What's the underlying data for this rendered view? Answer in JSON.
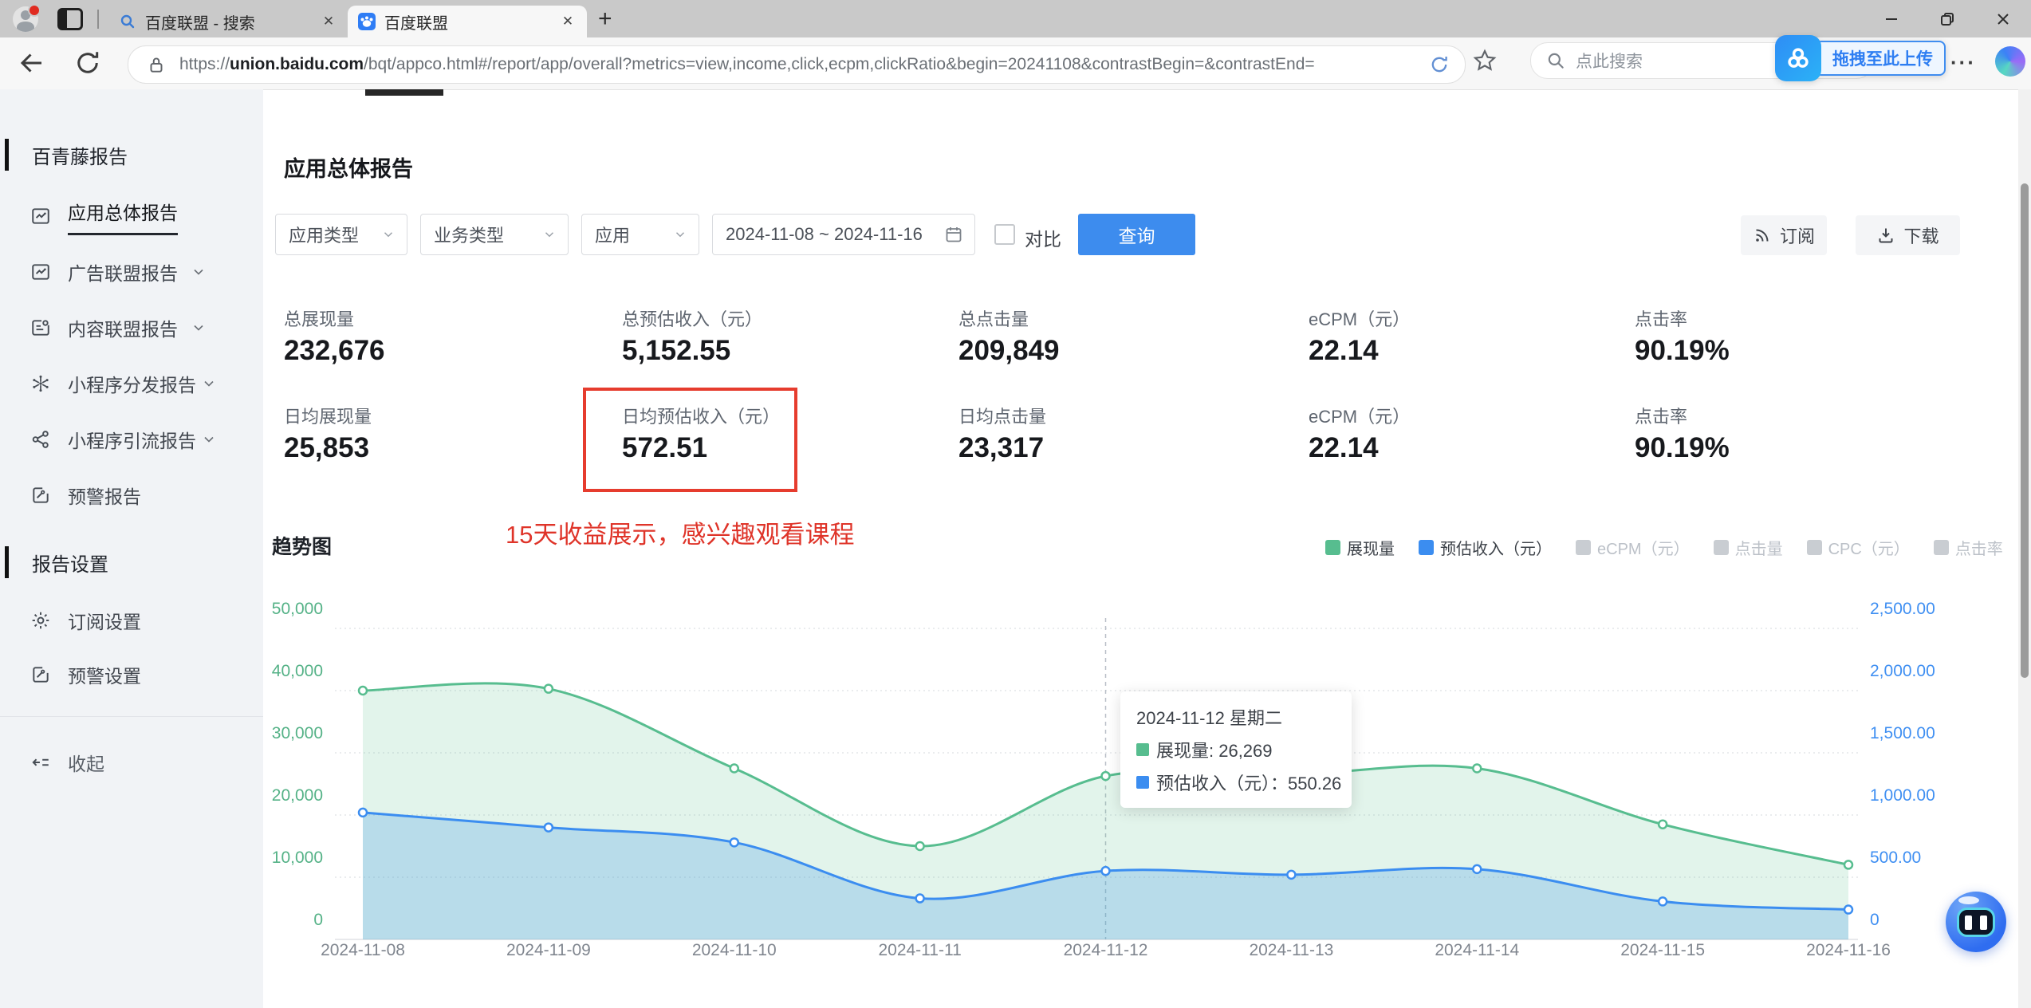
{
  "browser": {
    "tabs": [
      {
        "title": "百度联盟 - 搜索"
      },
      {
        "title": "百度联盟"
      }
    ],
    "url_prefix": "https://",
    "url_domain": "union.baidu.com",
    "url_path": "/bqt/appco.html#/report/app/overall?metrics=view,income,click,ecpm,clickRatio&begin=20241108&contrastBegin=&contrastEnd=",
    "search_placeholder": "点此搜索",
    "netdisk_badge": "拖拽至此上传"
  },
  "sidebar": {
    "section1": {
      "title": "百青藤报告"
    },
    "items1": [
      {
        "label": "应用总体报告"
      },
      {
        "label": "广告联盟报告"
      },
      {
        "label": "内容联盟报告"
      },
      {
        "label": "小程序分发报告"
      },
      {
        "label": "小程序引流报告"
      },
      {
        "label": "预警报告"
      }
    ],
    "section2": {
      "title": "报告设置"
    },
    "items2": [
      {
        "label": "订阅设置"
      },
      {
        "label": "预警设置"
      }
    ],
    "collapse": "收起"
  },
  "main": {
    "title": "应用总体报告",
    "filters": {
      "app_type": "应用类型",
      "biz_type": "业务类型",
      "app": "应用",
      "date_range": "2024-11-08 ~ 2024-11-16",
      "compare": "对比",
      "query": "查询",
      "subscribe": "订阅",
      "download": "下载"
    },
    "stats_row1": [
      {
        "label": "总展现量",
        "value": "232,676"
      },
      {
        "label": "总预估收入（元）",
        "value": "5,152.55"
      },
      {
        "label": "总点击量",
        "value": "209,849"
      },
      {
        "label": "eCPM（元）",
        "value": "22.14"
      },
      {
        "label": "点击率",
        "value": "90.19%"
      }
    ],
    "stats_row2": [
      {
        "label": "日均展现量",
        "value": "25,853"
      },
      {
        "label": "日均预估收入（元）",
        "value": "572.51"
      },
      {
        "label": "日均点击量",
        "value": "23,317"
      },
      {
        "label": "eCPM（元）",
        "value": "22.14"
      },
      {
        "label": "点击率",
        "value": "90.19%"
      }
    ],
    "annotation": "15天收益展示，感兴趣观看课程"
  },
  "chart_data": {
    "type": "area",
    "title": "趋势图",
    "x": [
      "2024-11-08",
      "2024-11-09",
      "2024-11-10",
      "2024-11-11",
      "2024-11-12",
      "2024-11-13",
      "2024-11-14",
      "2024-11-15",
      "2024-11-16"
    ],
    "series": [
      {
        "name": "展现量",
        "axis": "left",
        "color": "#57bd8f",
        "fill": "rgba(96,196,146,0.18)",
        "values": [
          40000,
          40300,
          27500,
          15000,
          26269,
          26500,
          27500,
          18500,
          12000
        ]
      },
      {
        "name": "预估收入（元）",
        "axis": "right",
        "color": "#3b8df0",
        "fill": "rgba(77,157,235,0.28)",
        "values": [
          1020,
          900,
          780,
          330,
          550.26,
          520,
          565,
          305,
          240
        ]
      }
    ],
    "legend": [
      {
        "label": "展现量",
        "color": "#57bd8f",
        "disabled": false
      },
      {
        "label": "预估收入（元）",
        "color": "#3b8df0",
        "disabled": false
      },
      {
        "label": "eCPM（元）",
        "color": "#c9cdd2",
        "disabled": true
      },
      {
        "label": "点击量",
        "color": "#c9cdd2",
        "disabled": true
      },
      {
        "label": "CPC（元）",
        "color": "#c9cdd2",
        "disabled": true
      },
      {
        "label": "点击率",
        "color": "#c9cdd2",
        "disabled": true
      }
    ],
    "left_axis": {
      "max": 50000,
      "ticks": [
        "50,000",
        "40,000",
        "30,000",
        "20,000",
        "10,000",
        "0"
      ],
      "color": "#55b287"
    },
    "right_axis": {
      "max": 2500,
      "ticks": [
        "2,500.00",
        "2,000.00",
        "1,500.00",
        "1,000.00",
        "500.00",
        "0"
      ],
      "color": "#3f8ff2"
    },
    "grid": true,
    "legend_position": "top-right",
    "tooltip": {
      "title": "2024-11-12 星期二",
      "index": 4,
      "rows": [
        {
          "text": "展现量: 26,269"
        },
        {
          "text": "预估收入（元）：550.26"
        }
      ]
    }
  }
}
